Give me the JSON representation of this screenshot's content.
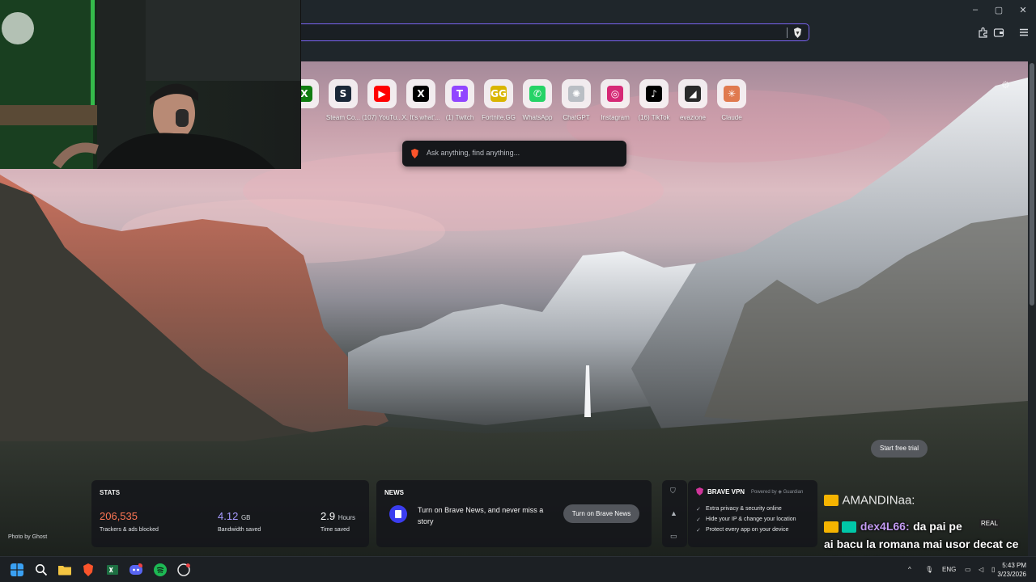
{
  "browser": {
    "address_value": "",
    "window_controls": [
      "–",
      "▢",
      "✕"
    ]
  },
  "top_sites": [
    {
      "label": "",
      "icon": "xbox-icon",
      "color": "#107c10",
      "glyph": "X"
    },
    {
      "label": "Steam Co...",
      "icon": "steam-icon",
      "color": "#1b2838",
      "glyph": "S"
    },
    {
      "label": "(107) YouTu...",
      "icon": "youtube-icon",
      "color": "#ff0000",
      "glyph": "▶"
    },
    {
      "label": "X. It's what'...",
      "icon": "x-icon",
      "color": "#000000",
      "glyph": "X"
    },
    {
      "label": "(1) Twitch",
      "icon": "twitch-icon",
      "color": "#9146ff",
      "glyph": "T"
    },
    {
      "label": "Fortnite.GG",
      "icon": "fortnitegg-icon",
      "color": "#d9b500",
      "glyph": "GG"
    },
    {
      "label": "WhatsApp",
      "icon": "whatsapp-icon",
      "color": "#25d366",
      "glyph": "✆"
    },
    {
      "label": "ChatGPT",
      "icon": "chatgpt-icon",
      "color": "#b9bec4",
      "glyph": "✺"
    },
    {
      "label": "Instagram",
      "icon": "instagram-icon",
      "color": "#d62976",
      "glyph": "◎"
    },
    {
      "label": "(16) TikTok",
      "icon": "tiktok-icon",
      "color": "#000000",
      "glyph": "♪"
    },
    {
      "label": "evazione",
      "icon": "evazione-icon",
      "color": "#2a2a2a",
      "glyph": "◢"
    },
    {
      "label": "Claude",
      "icon": "claude-icon",
      "color": "#e07a4f",
      "glyph": "✳"
    }
  ],
  "search": {
    "placeholder": "Ask anything, find anything..."
  },
  "stats": {
    "title": "STATS",
    "trackers_value": "206,535",
    "trackers_label": "Trackers & ads blocked",
    "bandwidth_value": "4.12",
    "bandwidth_unit": "GB",
    "bandwidth_label": "Bandwidth saved",
    "time_value": "2.9",
    "time_unit": "Hours",
    "time_label": "Time saved"
  },
  "news": {
    "title": "NEWS",
    "text": "Turn on Brave News, and never miss a story",
    "button": "Turn on Brave News"
  },
  "vpn": {
    "title": "BRAVE VPN",
    "powered": "Powered by ◈ Guardian",
    "features": [
      "Extra privacy & security online",
      "Hide your IP & change your location",
      "Protect every app on your device"
    ],
    "trial_button": "Start free trial"
  },
  "photo_credit": "Photo by Ghost",
  "chat": {
    "user1": "AMANDINaa:",
    "user2": "dex4L66:",
    "message2": "da pai pe",
    "message2_cont": "ai bacu la romana mai usor decat ce e la social",
    "badge": "REAL"
  },
  "taskbar": {
    "lang": "ENG",
    "time": "5:43 PM",
    "date": "3/23/2026",
    "accent": "#fb542b"
  }
}
